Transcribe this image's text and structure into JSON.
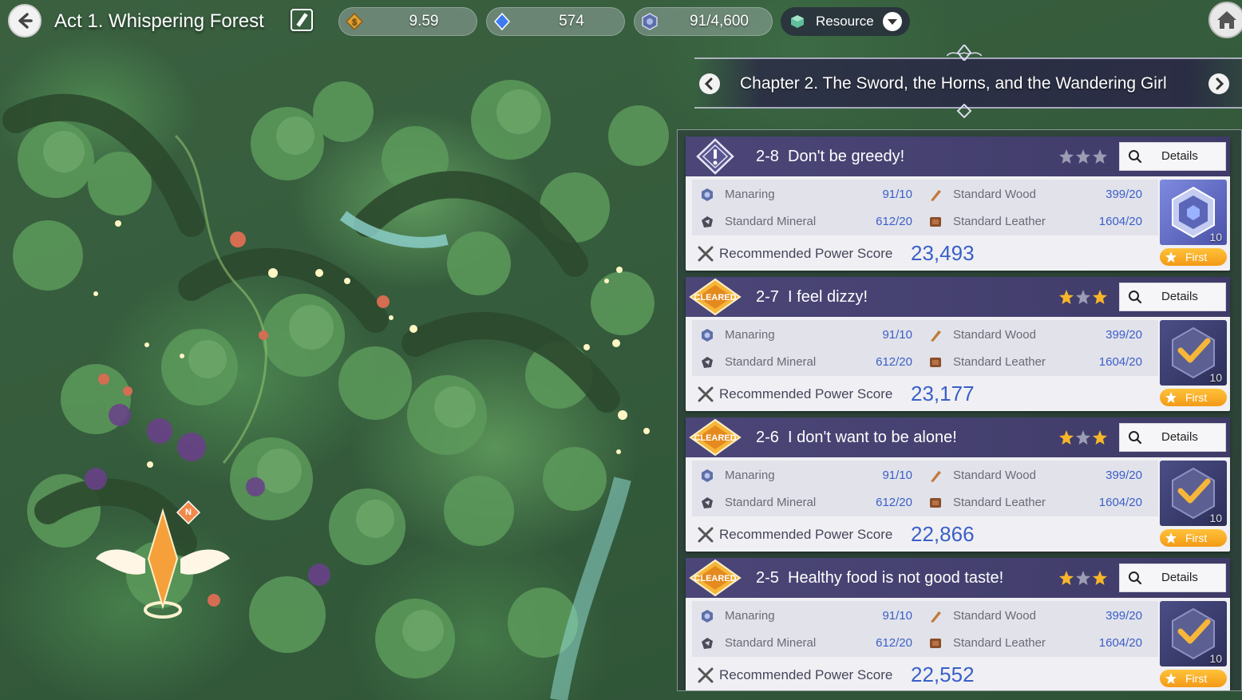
{
  "header": {
    "act_title": "Act 1. Whispering Forest",
    "currencies": {
      "gold": "9.59",
      "gem": "574",
      "manaring": "91/4,600"
    },
    "resource_label": "Resource"
  },
  "chapter": {
    "title": "Chapter 2. The Sword, the Horns, and the Wandering Girl"
  },
  "map": {
    "marker_label": "N"
  },
  "stages": [
    {
      "number": "2-8",
      "title": "Don't be greedy!",
      "status": "current",
      "stars_earned": 0,
      "details_label": "Details",
      "drops": [
        {
          "name": "Manaring",
          "count": "91/10",
          "icon": "manaring-icon"
        },
        {
          "name": "Standard Wood",
          "count": "399/20",
          "icon": "wood-icon"
        },
        {
          "name": "Standard Mineral",
          "count": "612/20",
          "icon": "mineral-icon"
        },
        {
          "name": "Standard Leather",
          "count": "1604/20",
          "icon": "leather-icon"
        }
      ],
      "power_label": "Recommended Power Score",
      "power_value": "23,493",
      "reward_count": "10",
      "first_label": "First"
    },
    {
      "number": "2-7",
      "title": "I feel dizzy!",
      "status": "cleared",
      "badge_label": "CLEARED",
      "stars_earned": 2,
      "details_label": "Details",
      "drops": [
        {
          "name": "Manaring",
          "count": "91/10",
          "icon": "manaring-icon"
        },
        {
          "name": "Standard Wood",
          "count": "399/20",
          "icon": "wood-icon"
        },
        {
          "name": "Standard Mineral",
          "count": "612/20",
          "icon": "mineral-icon"
        },
        {
          "name": "Standard Leather",
          "count": "1604/20",
          "icon": "leather-icon"
        }
      ],
      "power_label": "Recommended Power Score",
      "power_value": "23,177",
      "reward_count": "10",
      "first_label": "First"
    },
    {
      "number": "2-6",
      "title": "I don't want to be alone!",
      "status": "cleared",
      "badge_label": "CLEARED",
      "stars_earned": 2,
      "details_label": "Details",
      "drops": [
        {
          "name": "Manaring",
          "count": "91/10",
          "icon": "manaring-icon"
        },
        {
          "name": "Standard Wood",
          "count": "399/20",
          "icon": "wood-icon"
        },
        {
          "name": "Standard Mineral",
          "count": "612/20",
          "icon": "mineral-icon"
        },
        {
          "name": "Standard Leather",
          "count": "1604/20",
          "icon": "leather-icon"
        }
      ],
      "power_label": "Recommended Power Score",
      "power_value": "22,866",
      "reward_count": "10",
      "first_label": "First"
    },
    {
      "number": "2-5",
      "title": "Healthy food is not good taste!",
      "status": "cleared",
      "badge_label": "CLEARED",
      "stars_earned": 2,
      "details_label": "Details",
      "drops": [
        {
          "name": "Manaring",
          "count": "91/10",
          "icon": "manaring-icon"
        },
        {
          "name": "Standard Wood",
          "count": "399/20",
          "icon": "wood-icon"
        },
        {
          "name": "Standard Mineral",
          "count": "612/20",
          "icon": "mineral-icon"
        },
        {
          "name": "Standard Leather",
          "count": "1604/20",
          "icon": "leather-icon"
        }
      ],
      "power_label": "Recommended Power Score",
      "power_value": "22,552",
      "reward_count": "10",
      "first_label": "First"
    }
  ],
  "colors": {
    "panel_header": "#4b4677",
    "accent_blue": "#3a5fc8",
    "star_gold": "#f7b62a",
    "first_orange": "#f39a17"
  }
}
